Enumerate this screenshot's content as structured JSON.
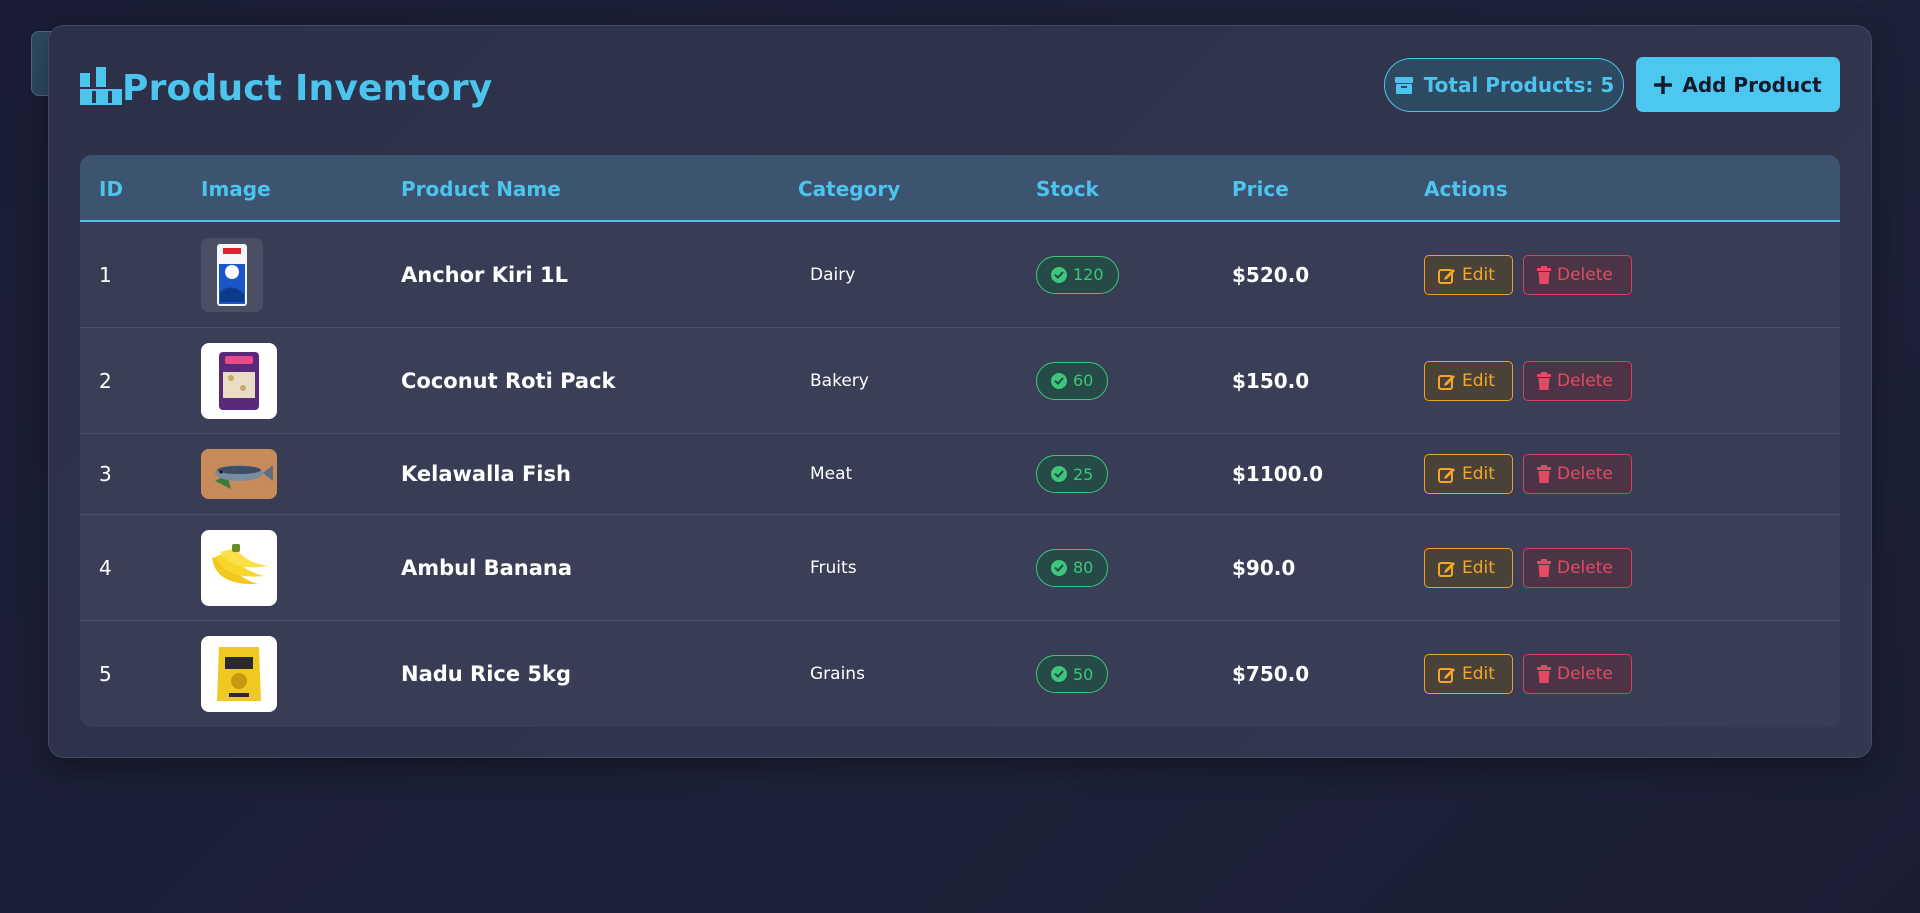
{
  "header": {
    "title": "Product Inventory",
    "total_label": "Total Products: 5",
    "add_label": "Add Product"
  },
  "table": {
    "columns": [
      "ID",
      "Image",
      "Product Name",
      "Category",
      "Stock",
      "Price",
      "Actions"
    ],
    "rows": [
      {
        "id": "1",
        "name": "Anchor Kiri 1L",
        "category": "Dairy",
        "stock": "120",
        "price": "$520.0",
        "edit": "Edit",
        "delete": "Delete",
        "image": "milk-powder-pack-image"
      },
      {
        "id": "2",
        "name": "Coconut Roti Pack",
        "category": "Bakery",
        "stock": "60",
        "price": "$150.0",
        "edit": "Edit",
        "delete": "Delete",
        "image": "roti-pack-image"
      },
      {
        "id": "3",
        "name": "Kelawalla Fish",
        "category": "Meat",
        "stock": "25",
        "price": "$1100.0",
        "edit": "Edit",
        "delete": "Delete",
        "image": "fish-image"
      },
      {
        "id": "4",
        "name": "Ambul Banana",
        "category": "Fruits",
        "stock": "80",
        "price": "$90.0",
        "edit": "Edit",
        "delete": "Delete",
        "image": "banana-image"
      },
      {
        "id": "5",
        "name": "Nadu Rice 5kg",
        "category": "Grains",
        "stock": "50",
        "price": "$750.0",
        "edit": "Edit",
        "delete": "Delete",
        "image": "rice-bag-image"
      }
    ]
  },
  "colors": {
    "accent": "#4cc4ee",
    "stock_green": "#3ec67a",
    "edit_orange": "#f4a722",
    "delete_red": "#e44a63"
  }
}
